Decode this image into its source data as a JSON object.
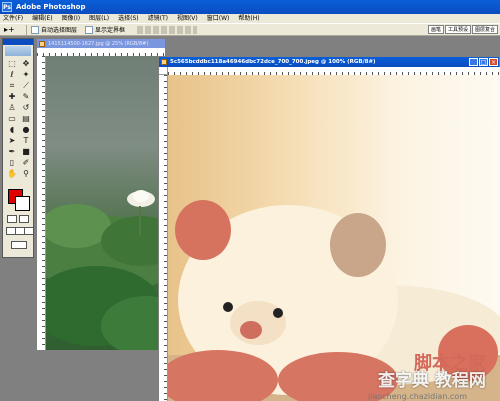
{
  "app": {
    "title": "Adobe Photoshop",
    "logo_text": "Ps"
  },
  "menu": [
    "文件(F)",
    "编辑(E)",
    "图像(I)",
    "图层(L)",
    "选择(S)",
    "滤镜(T)",
    "视图(V)",
    "窗口(W)",
    "帮助(H)"
  ],
  "options": {
    "move_tool_glyph": "▸+",
    "auto_select_label": "自动选择图层",
    "show_bounds_label": "显示定界框",
    "palette_tabs": [
      "画笔",
      "工具预设",
      "图层复合"
    ]
  },
  "toolbox": {
    "tools": [
      {
        "name": "marquee-tool-icon",
        "glyph": "⬚"
      },
      {
        "name": "move-tool-icon",
        "glyph": "✥"
      },
      {
        "name": "lasso-tool-icon",
        "glyph": "ℓ"
      },
      {
        "name": "magic-wand-tool-icon",
        "glyph": "✦"
      },
      {
        "name": "crop-tool-icon",
        "glyph": "⌗"
      },
      {
        "name": "slice-tool-icon",
        "glyph": "⟋"
      },
      {
        "name": "healing-brush-tool-icon",
        "glyph": "✚"
      },
      {
        "name": "brush-tool-icon",
        "glyph": "✎"
      },
      {
        "name": "stamp-tool-icon",
        "glyph": "♙"
      },
      {
        "name": "history-brush-tool-icon",
        "glyph": "↺"
      },
      {
        "name": "eraser-tool-icon",
        "glyph": "▭"
      },
      {
        "name": "gradient-tool-icon",
        "glyph": "▤"
      },
      {
        "name": "blur-tool-icon",
        "glyph": "◖"
      },
      {
        "name": "dodge-tool-icon",
        "glyph": "●"
      },
      {
        "name": "path-selection-tool-icon",
        "glyph": "➤"
      },
      {
        "name": "type-tool-icon",
        "glyph": "T"
      },
      {
        "name": "pen-tool-icon",
        "glyph": "✒"
      },
      {
        "name": "shape-tool-icon",
        "glyph": "■"
      },
      {
        "name": "notes-tool-icon",
        "glyph": "▯"
      },
      {
        "name": "eyedropper-tool-icon",
        "glyph": "✐"
      },
      {
        "name": "hand-tool-icon",
        "glyph": "✋"
      },
      {
        "name": "zoom-tool-icon",
        "glyph": "⚲"
      }
    ],
    "foreground_color": "#e00000",
    "background_color": "#ffffff"
  },
  "documents": [
    {
      "title": "1415114500-1627.jpg @ 25% (RGB/8#)"
    },
    {
      "title": "5c565bcddbc118a46946dbc72dce_700_700.jpeg @ 100% (RGB/8#)"
    }
  ],
  "watermarks": {
    "site_logo": "脚本之家",
    "site_name": "查字典 教程网",
    "site_url": "jiaocheng.chazidian.com"
  }
}
